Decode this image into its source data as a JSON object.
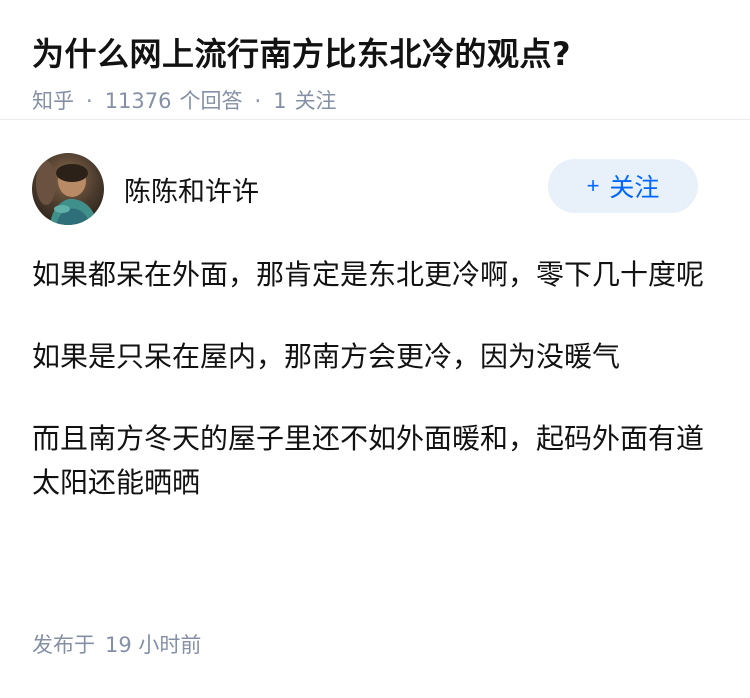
{
  "question": {
    "title": "为什么网上流行南方比东北冷的观点?",
    "source": "知乎",
    "answer_count": "11376",
    "answer_label": "个回答",
    "follow_count": "1",
    "follow_label": "关注"
  },
  "answer": {
    "author": {
      "name": "陈陈和许许",
      "avatar_icon": "user-avatar-photo"
    },
    "follow_button": {
      "icon": "plus-icon",
      "label": "关注",
      "accent_color": "#0066ff",
      "bg_color": "#e8f0fa"
    },
    "paragraphs": [
      "如果都呆在外面，那肯定是东北更冷啊，零下几十度呢",
      "如果是只呆在屋内，那南方会更冷，因为没暖气",
      "而且南方冬天的屋子里还不如外面暖和，起码外面有道太阳还能晒晒"
    ],
    "published_label": "发布于",
    "published_time": "19 小时前"
  },
  "colors": {
    "text": "#121212",
    "meta": "#8590a6",
    "divider": "#ebebeb"
  }
}
